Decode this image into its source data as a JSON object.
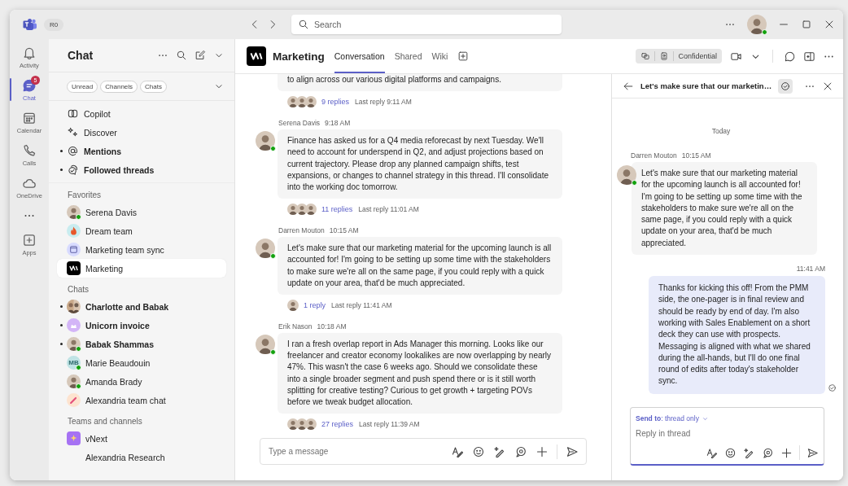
{
  "title_bar": {
    "account": "R0",
    "search_placeholder": "Search",
    "user_online": true
  },
  "rail": [
    {
      "kind": "app",
      "label": "Activity",
      "selected": false
    },
    {
      "kind": "app",
      "label": "Chat",
      "selected": true,
      "badge": "5"
    },
    {
      "kind": "app",
      "label": "Calendar",
      "selected": false
    },
    {
      "kind": "app",
      "label": "Calls",
      "selected": false
    },
    {
      "kind": "app",
      "label": "OneDrive",
      "selected": false
    },
    {
      "kind": "more"
    },
    {
      "kind": "app",
      "label": "Apps",
      "selected": false
    }
  ],
  "sidebar": {
    "title": "Chat",
    "filters": [
      "Unread",
      "Channels",
      "Chats"
    ],
    "pinned": [
      {
        "label": "Copilot",
        "unread": false
      },
      {
        "label": "Discover",
        "unread": false
      },
      {
        "label": "Mentions",
        "unread": true
      },
      {
        "label": "Followed threads",
        "unread": true
      }
    ],
    "sections": [
      {
        "heading": "Favorites",
        "items": [
          {
            "label": "Serena Davis",
            "kind": "person",
            "online": true,
            "unread": false,
            "selected": false
          },
          {
            "label": "Dream team",
            "kind": "team",
            "online": false,
            "unread": false,
            "selected": false
          },
          {
            "label": "Marketing team sync",
            "kind": "meeting",
            "online": false,
            "unread": false,
            "selected": false
          },
          {
            "label": "Marketing",
            "kind": "channel",
            "online": false,
            "unread": false,
            "selected": true
          }
        ]
      },
      {
        "heading": "Chats",
        "items": [
          {
            "label": "Charlotte and Babak",
            "kind": "group",
            "online": false,
            "unread": true,
            "selected": false
          },
          {
            "label": "Unicorn invoice",
            "kind": "team",
            "online": false,
            "unread": true,
            "selected": false
          },
          {
            "label": "Babak Shammas",
            "kind": "person",
            "online": true,
            "unread": true,
            "selected": false
          },
          {
            "label": "Marie Beaudouin",
            "kind": "initials",
            "initials": "MB",
            "online": true,
            "unread": false,
            "selected": false
          },
          {
            "label": "Amanda Brady",
            "kind": "person",
            "online": true,
            "unread": false,
            "selected": false
          },
          {
            "label": "Alexandria team chat",
            "kind": "team",
            "online": false,
            "unread": false,
            "selected": false
          }
        ]
      },
      {
        "heading": "Teams and channels",
        "items": [
          {
            "label": "vNext",
            "kind": "channel",
            "online": false,
            "unread": false,
            "selected": false
          },
          {
            "label": "Alexandria Research",
            "kind": "none",
            "online": false,
            "unread": false,
            "selected": false
          }
        ]
      }
    ]
  },
  "channel": {
    "name": "Marketing",
    "tabs": [
      {
        "label": "Conversation",
        "selected": true
      },
      {
        "label": "Shared",
        "selected": false
      },
      {
        "label": "Wiki",
        "selected": false
      }
    ],
    "sensitivity": "Confidential"
  },
  "posts": [
    {
      "kind": "continued",
      "text": "to align across our various digital platforms and campaigns.",
      "repliers": [
        {
          "kind": "person"
        },
        {
          "kind": "person"
        },
        {
          "kind": "person"
        }
      ],
      "replies": "9 replies",
      "last_reply": "Last reply 9:11 AM"
    },
    {
      "kind": "post",
      "author": "Serena Davis",
      "time": "9:18 AM",
      "online": true,
      "text": "Finance has asked us for a Q4 media reforecast by next Tuesday. We'll need to account for underspend in Q2, and adjust projections based on current trajectory. Please drop any planned campaign shifts, test expansions, or changes to channel strategy in this thread. I'll consolidate into the working doc tomorrow.",
      "repliers": [
        {
          "kind": "person"
        },
        {
          "kind": "person"
        },
        {
          "kind": "person"
        }
      ],
      "replies": "11 replies",
      "last_reply": "Last reply 11:01 AM"
    },
    {
      "kind": "post",
      "author": "Darren Mouton",
      "time": "10:15 AM",
      "online": true,
      "text": "Let's make sure that our marketing material for the upcoming launch is all accounted for! I'm going to be setting up some time with the stakeholders to make sure we're all on the same page, if you could reply with a quick update on your area, that'd be much appreciated.",
      "repliers": [
        {
          "kind": "person"
        }
      ],
      "replies": "1 reply",
      "last_reply": "Last reply 11:41 AM"
    },
    {
      "kind": "post",
      "author": "Erik Nason",
      "time": "10:18 AM",
      "online": true,
      "text": "I ran a fresh overlap report in Ads Manager this morning. Looks like our freelancer and creator economy lookalikes are now overlapping by nearly 47%. This wasn't the case 6 weeks ago. Should we consolidate these into a single broader segment and push spend there or is it still worth splitting for creative testing? Curious to get growth + targeting POVs before we tweak budget allocation.",
      "repliers": [
        {
          "kind": "person"
        },
        {
          "kind": "person"
        },
        {
          "kind": "person"
        }
      ],
      "replies": "27 replies",
      "last_reply": "Last reply 11:39 AM"
    }
  ],
  "composer": {
    "placeholder": "Type a message"
  },
  "thread": {
    "title": "Let's make sure that our marketin…",
    "day": "Today",
    "messages": [
      {
        "kind": "received",
        "author": "Darren Mouton",
        "time": "10:15 AM",
        "online": true,
        "text": "Let's make sure that our marketing material for the upcoming launch is all accounted for! I'm going to be setting up some time with the stakeholders to make sure we're all on the same page, if you could reply with a quick update on your area, that'd be much appreciated."
      },
      {
        "kind": "sent",
        "time": "11:41 AM",
        "seen": true,
        "text": "Thanks for kicking this off! From the PMM side, the one-pager is in final review and should be ready by end of day. I'm also working with Sales Enablement on a short deck they can use with prospects. Messaging is aligned with what we shared during the all-hands, but I'll do one final round of edits after today's stakeholder sync."
      }
    ],
    "send_to": "**Send to**: thread only",
    "reply_placeholder": "Reply in thread"
  }
}
